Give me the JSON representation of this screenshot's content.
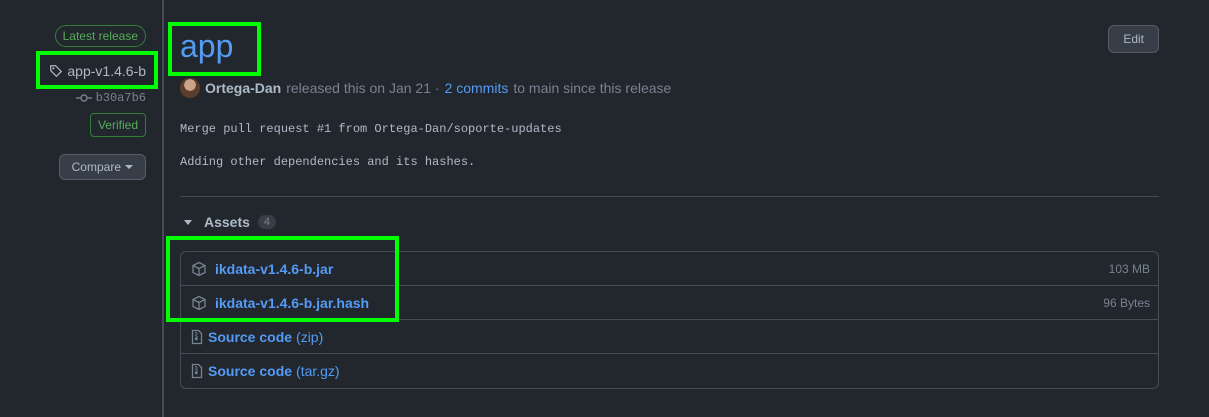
{
  "sidebar": {
    "latest_label": "Latest release",
    "tag": "app-v1.4.6-b",
    "commit": "b30a7b6",
    "verified": "Verified",
    "compare": "Compare"
  },
  "release": {
    "title": "app",
    "edit": "Edit",
    "author": "Ortega-Dan",
    "released_text": "released this on Jan 21 ·",
    "commits_link": "2 commits",
    "commits_suffix": "to main since this release",
    "notes": [
      "Merge pull request #1 from Ortega-Dan/soporte-updates",
      "Adding other dependencies and its hashes."
    ]
  },
  "assets": {
    "label": "Assets",
    "count": "4",
    "items": [
      {
        "name": "ikdata-v1.4.6-b.jar",
        "size": "103 MB",
        "icon": "package-icon"
      },
      {
        "name": "ikdata-v1.4.6-b.jar.hash",
        "size": "96 Bytes",
        "icon": "package-icon"
      },
      {
        "name": "Source code",
        "suffix": "(zip)",
        "icon": "file-zip-icon"
      },
      {
        "name": "Source code",
        "suffix": "(tar.gz)",
        "icon": "file-zip-icon"
      }
    ]
  },
  "colors": {
    "background": "#22272e",
    "link": "#539bf5",
    "success": "#57ab5a",
    "highlight": "#00ff00"
  }
}
